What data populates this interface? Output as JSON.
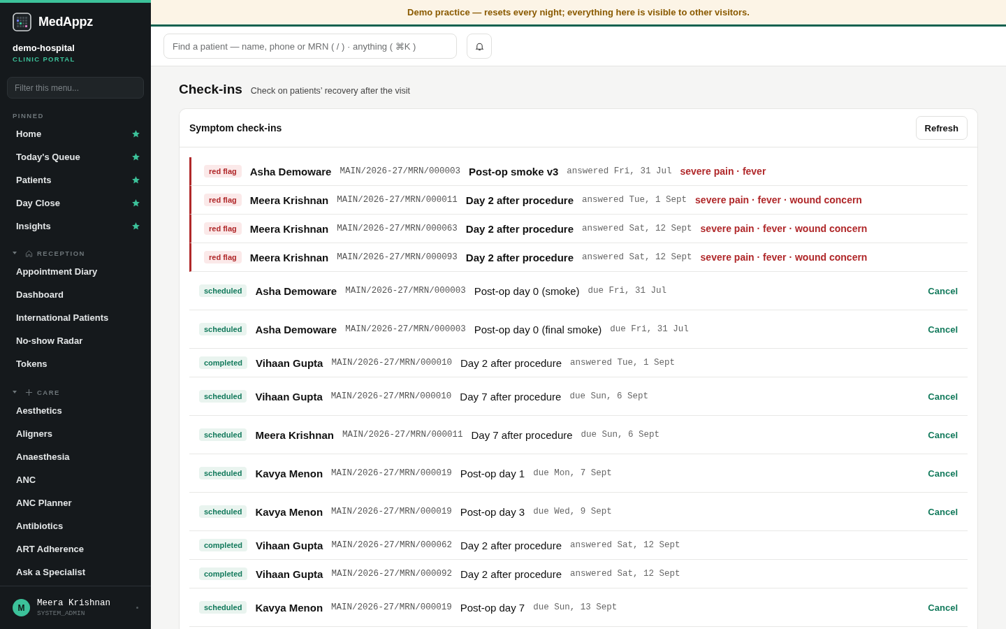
{
  "brand": {
    "name": "MedAppz",
    "org": "demo-hospital",
    "portal": "CLINIC PORTAL"
  },
  "sidebar": {
    "filter_placeholder": "Filter this menu...",
    "pinned": {
      "label": "PINNED",
      "items": [
        "Home",
        "Today's Queue",
        "Patients",
        "Day Close",
        "Insights"
      ]
    },
    "sections": [
      {
        "label": "RECEPTION",
        "kind": "home",
        "expanded": true,
        "items": [
          "Appointment Diary",
          "Dashboard",
          "International Patients",
          "No-show Radar",
          "Tokens"
        ]
      },
      {
        "label": "CARE",
        "kind": "plus",
        "expanded": true,
        "items": [
          "Aesthetics",
          "Aligners",
          "Anaesthesia",
          "ANC",
          "ANC Planner",
          "Antibiotics",
          "ART Adherence",
          "Ask a Specialist"
        ]
      }
    ],
    "user": {
      "initial": "M",
      "name": "Meera Krishnan",
      "role": "SYSTEM_ADMIN"
    }
  },
  "banner": "Demo practice — resets every night; everything here is visible to other visitors.",
  "search": {
    "placeholder": "Find a patient — name, phone or MRN ( / ) · anything ( ⌘K )"
  },
  "page": {
    "title": "Check-ins",
    "subtitle": "Check on patients’ recovery after the visit"
  },
  "card": {
    "title": "Symptom check-ins",
    "refresh": "Refresh",
    "rows": [
      {
        "kind": "red_flag",
        "status": "red flag",
        "name": "Asha Demoware",
        "mrn": "MAIN/2026-27/MRN/000003",
        "title": "Post-op smoke v3",
        "when": "answered Fri, 31 Jul",
        "flags": "severe pain · fever"
      },
      {
        "kind": "red_flag",
        "status": "red flag",
        "name": "Meera Krishnan",
        "mrn": "MAIN/2026-27/MRN/000011",
        "title": "Day 2 after procedure",
        "when": "answered Tue, 1 Sept",
        "flags": "severe pain · fever · wound concern"
      },
      {
        "kind": "red_flag",
        "status": "red flag",
        "name": "Meera Krishnan",
        "mrn": "MAIN/2026-27/MRN/000063",
        "title": "Day 2 after procedure",
        "when": "answered Sat, 12 Sept",
        "flags": "severe pain · fever · wound concern"
      },
      {
        "kind": "red_flag",
        "status": "red flag",
        "name": "Meera Krishnan",
        "mrn": "MAIN/2026-27/MRN/000093",
        "title": "Day 2 after procedure",
        "when": "answered Sat, 12 Sept",
        "flags": "severe pain · fever · wound concern"
      },
      {
        "kind": "scheduled",
        "status": "scheduled",
        "name": "Asha Demoware",
        "mrn": "MAIN/2026-27/MRN/000003",
        "title": "Post-op day 0 (smoke)",
        "when": "due Fri, 31 Jul",
        "action": "Cancel"
      },
      {
        "kind": "scheduled",
        "status": "scheduled",
        "name": "Asha Demoware",
        "mrn": "MAIN/2026-27/MRN/000003",
        "title": "Post-op day 0 (final smoke)",
        "when": "due Fri, 31 Jul",
        "action": "Cancel"
      },
      {
        "kind": "completed",
        "status": "completed",
        "name": "Vihaan Gupta",
        "mrn": "MAIN/2026-27/MRN/000010",
        "title": "Day 2 after procedure",
        "when": "answered Tue, 1 Sept"
      },
      {
        "kind": "scheduled",
        "status": "scheduled",
        "name": "Vihaan Gupta",
        "mrn": "MAIN/2026-27/MRN/000010",
        "title": "Day 7 after procedure",
        "when": "due Sun, 6 Sept",
        "action": "Cancel"
      },
      {
        "kind": "scheduled",
        "status": "scheduled",
        "name": "Meera Krishnan",
        "mrn": "MAIN/2026-27/MRN/000011",
        "title": "Day 7 after procedure",
        "when": "due Sun, 6 Sept",
        "action": "Cancel"
      },
      {
        "kind": "scheduled",
        "status": "scheduled",
        "name": "Kavya Menon",
        "mrn": "MAIN/2026-27/MRN/000019",
        "title": "Post-op day 1",
        "when": "due Mon, 7 Sept",
        "action": "Cancel"
      },
      {
        "kind": "scheduled",
        "status": "scheduled",
        "name": "Kavya Menon",
        "mrn": "MAIN/2026-27/MRN/000019",
        "title": "Post-op day 3",
        "when": "due Wed, 9 Sept",
        "action": "Cancel"
      },
      {
        "kind": "completed",
        "status": "completed",
        "name": "Vihaan Gupta",
        "mrn": "MAIN/2026-27/MRN/000062",
        "title": "Day 2 after procedure",
        "when": "answered Sat, 12 Sept"
      },
      {
        "kind": "completed",
        "status": "completed",
        "name": "Vihaan Gupta",
        "mrn": "MAIN/2026-27/MRN/000092",
        "title": "Day 2 after procedure",
        "when": "answered Sat, 12 Sept"
      },
      {
        "kind": "scheduled",
        "status": "scheduled",
        "name": "Kavya Menon",
        "mrn": "MAIN/2026-27/MRN/000019",
        "title": "Post-op day 7",
        "when": "due Sun, 13 Sept",
        "action": "Cancel"
      }
    ]
  }
}
